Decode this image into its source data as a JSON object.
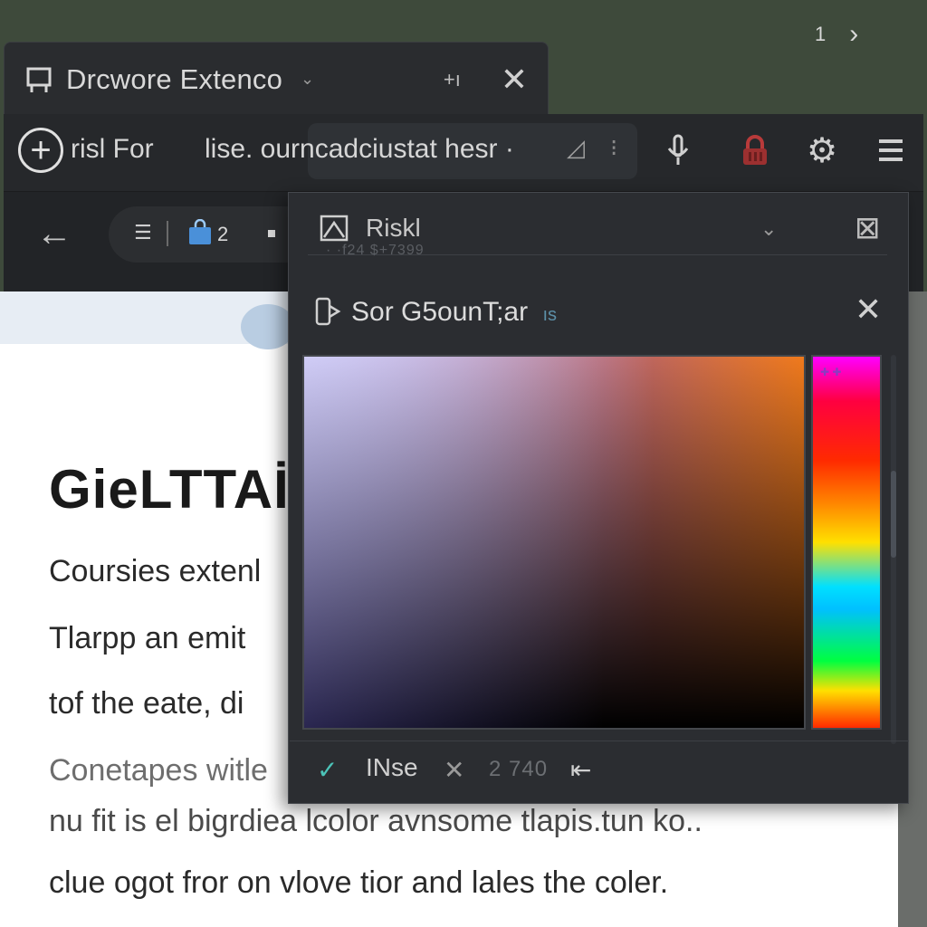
{
  "pager": {
    "page": "1",
    "next_icon": "chevron-right-icon"
  },
  "tab": {
    "title": "Drcwore Extenco",
    "dropdown_icon": "chevron-down-icon",
    "extra": "+ı",
    "close_icon": "close-icon"
  },
  "address_bar": {
    "left_text": "risl For",
    "field_text": "lise. ourncadciustat hesr ·",
    "icons": [
      "add-circle-icon",
      "triangle-icon",
      "more-icon",
      "mic-icon",
      "lock-icon",
      "gear-icon",
      "menu-icon"
    ]
  },
  "nav_bar": {
    "back_icon": "back-arrow-icon",
    "list_icon": "list-icon",
    "bag_icon": "shopping-bag-icon",
    "count": "2"
  },
  "page": {
    "heading": "GieLTTAİE",
    "paragraphs": [
      "Coursies extenl",
      "Tlarpp an emit",
      "tof the eate, di",
      "Conetapes witle",
      "nu fit is el bigrdiea lcolor avnsome tlapis.tun ko..",
      "clue ogot fror on vlove tior and lales the coler."
    ]
  },
  "picker": {
    "header_title": "Riskl",
    "header_sub": "· ·f24 $+7399",
    "header_icons": [
      "image-icon",
      "chevron-down-icon",
      "close-icon"
    ],
    "title": "Sor G5ounT;ar",
    "title_mark": "ıs",
    "title_icon": "eyedropper-icon",
    "colors": {
      "sv_start": "#8a74c4",
      "sv_mid": "#b06070",
      "sv_end": "#f07a1c",
      "hue_top": "#ff00ff"
    },
    "footer": {
      "check_icon": "check-icon",
      "label": "INse",
      "shuffle_icon": "shuffle-icon",
      "value": "2 740",
      "pin_icon": "pin-icon"
    }
  }
}
